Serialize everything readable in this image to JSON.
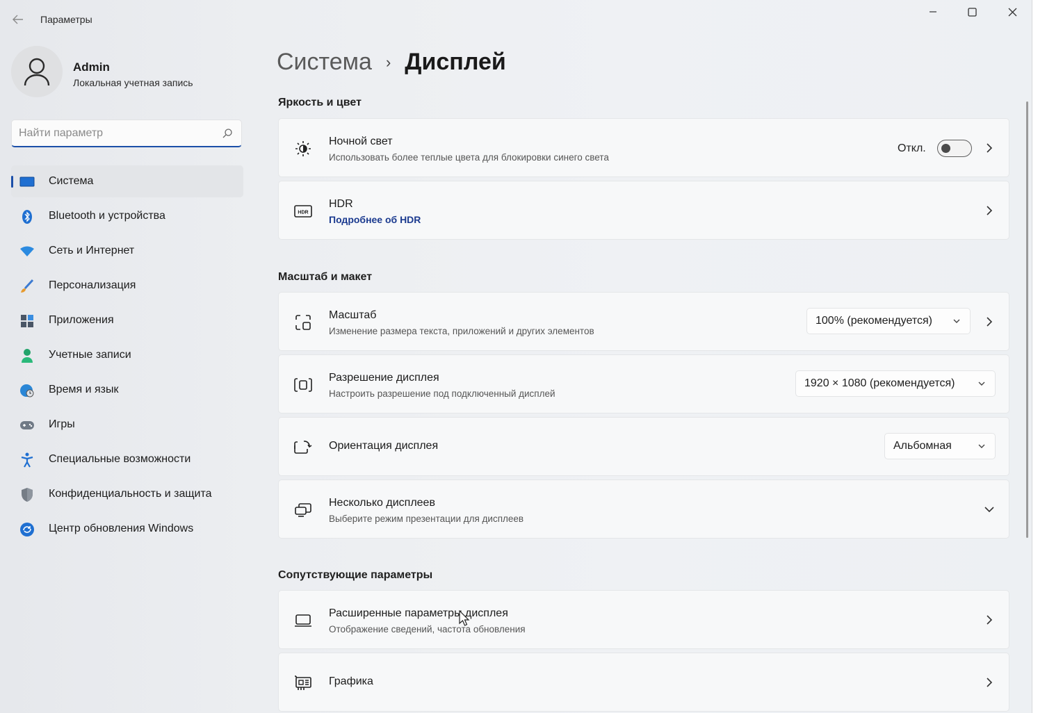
{
  "window": {
    "title": "Параметры"
  },
  "profile": {
    "name": "Admin",
    "account_type": "Локальная учетная запись"
  },
  "search": {
    "placeholder": "Найти параметр"
  },
  "sidebar": {
    "items": [
      {
        "label": "Система",
        "icon": "system-icon",
        "active": true
      },
      {
        "label": "Bluetooth и устройства",
        "icon": "bluetooth-icon"
      },
      {
        "label": "Сеть и Интернет",
        "icon": "network-icon"
      },
      {
        "label": "Персонализация",
        "icon": "brush-icon"
      },
      {
        "label": "Приложения",
        "icon": "apps-icon"
      },
      {
        "label": "Учетные записи",
        "icon": "account-icon"
      },
      {
        "label": "Время и язык",
        "icon": "globe-clock-icon"
      },
      {
        "label": "Игры",
        "icon": "gamepad-icon"
      },
      {
        "label": "Специальные возможности",
        "icon": "accessibility-icon"
      },
      {
        "label": "Конфиденциальность и защита",
        "icon": "shield-icon"
      },
      {
        "label": "Центр обновления Windows",
        "icon": "update-icon"
      }
    ]
  },
  "breadcrumb": {
    "parent": "Система",
    "separator": "›",
    "current": "Дисплей"
  },
  "sections": {
    "brightness": "Яркость и цвет",
    "scale_layout": "Масштаб и макет",
    "related": "Сопутствующие параметры"
  },
  "cards": {
    "night_light": {
      "title": "Ночной свет",
      "subtitle": "Использовать более теплые цвета для блокировки синего света",
      "toggle_state": "Откл.",
      "toggle_on": false
    },
    "hdr": {
      "title": "HDR",
      "link": "Подробнее об HDR"
    },
    "scale": {
      "title": "Масштаб",
      "subtitle": "Изменение размера текста, приложений и других элементов",
      "value": "100% (рекомендуется)"
    },
    "resolution": {
      "title": "Разрешение дисплея",
      "subtitle": "Настроить разрешение под подключенный дисплей",
      "value": "1920 × 1080 (рекомендуется)"
    },
    "orientation": {
      "title": "Ориентация дисплея",
      "value": "Альбомная"
    },
    "multiple": {
      "title": "Несколько дисплеев",
      "subtitle": "Выберите режим презентации для дисплеев"
    },
    "advanced": {
      "title": "Расширенные параметры дисплея",
      "subtitle": "Отображение сведений, частота обновления"
    },
    "graphics": {
      "title": "Графика"
    }
  },
  "colors": {
    "accent": "#1b4fa8",
    "link": "#1b3a8f"
  }
}
